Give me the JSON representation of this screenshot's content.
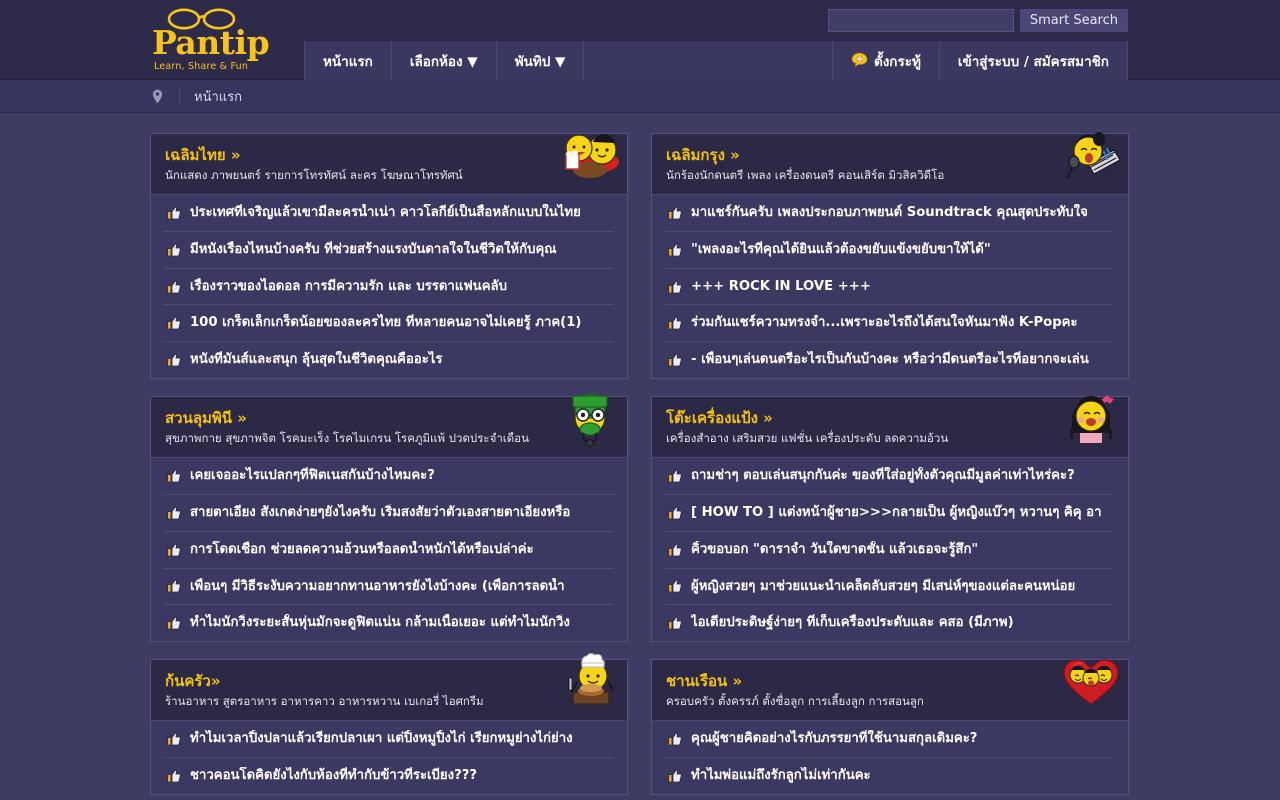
{
  "site": {
    "logo_word": "Pantip",
    "logo_tagline": "Learn, Share & Fun"
  },
  "header": {
    "search": {
      "value": "",
      "placeholder": ""
    },
    "search_button": "Smart Search",
    "nav": [
      {
        "label": "หน้าแรก",
        "icon": ""
      },
      {
        "label": "เลือกห้อง ▼",
        "icon": ""
      },
      {
        "label": "พันทิป ▼",
        "icon": ""
      }
    ],
    "nav_right": [
      {
        "label": "ตั้งกระทู้",
        "icon": "speech-bubble-plus-icon"
      },
      {
        "label": "เข้าสู่ระบบ / สมัครสมาชิก",
        "icon": ""
      }
    ]
  },
  "breadcrumb": {
    "icon": "map-pin-icon",
    "text": "หน้าแรก"
  },
  "cards": [
    {
      "title": "เฉลิมไทย »",
      "subtitle": "นักแสดง ภาพยนตร์ รายการโทรทัศน์ ละคร โฆษณาโทรทัศน์",
      "mascot": "popcorn-movie-mascot",
      "items": [
        "ประเทศที่เจริญแล้วเขามีละครน้ำเน่า คาวโลกีย์เป็นสื่อหลักแบบในไทย",
        "มีหนังเรื่องไหนบ้างครับ ที่ช่วยสร้างแรงบันดาลใจในชีวิตให้กับคุณ",
        "เรื่องราวของไอดอล การมีความรัก และ บรรดาแฟนคลับ",
        "100 เกร็ดเล็กเกร็ดน้อยของละครไทย ที่หลายคนอาจไม่เคยรู้ ภาค(1)",
        "หนังที่มันส์และสนุก ลุ้นสุดในชีวิตคุณคืออะไร"
      ]
    },
    {
      "title": "เฉลิมกรุง »",
      "subtitle": "นักร้องนักดนตรี เพลง เครื่องดนตรี คอนเสิร์ต มิวสิควิดีโอ",
      "mascot": "singer-microphone-mascot",
      "items": [
        "มาแชร์กันครับ เพลงประกอบภาพยนต์ Soundtrack คุณสุดประทับใจ",
        "\"เพลงอะไรที่คุณได้ยินแล้วต้องขยับแข้งขยับขาให้ได้\"",
        "+++ ROCK IN LOVE +++",
        "ร่วมกันแชร์ความทรงจำ...เพราะอะไรถึงได้สนใจหันมาฟัง K-Popคะ",
        "- เพื่อนๆเล่นดนตรีอะไรเป็นกันบ้างคะ หรือว่ามีดนตรีอะไรที่อยากจะเล่น"
      ]
    },
    {
      "title": "สวนลุมพินี »",
      "subtitle": "สุขภาพกาย สุขภาพจิต โรคมะเร็ง โรคไมเกรน โรคภูมิแพ้ ปวดประจำเดือน",
      "mascot": "green-doctor-mascot",
      "items": [
        "เคยเจออะไรแปลกๆที่ฟิตเนสกันบ้างไหมคะ?",
        "สายตาเอียง สังเกตง่ายๆยังไงครับ เริ่มสงสัยว่าตัวเองสายตาเอียงหรือ",
        "การโดดเชือก ช่วยลดความอ้วนหรือลดน้ำหนักได้หรือเปล่าค่ะ",
        "เพื่อนๆ มีวิธีระงับความอยากทานอาหารยังไงบ้างคะ (เพื่อการลดน้ำ",
        "ทำไมนักวิ่งระยะสั้นหุ่นมักจะดูฟิตแน่น กล้ามเนื้อเยอะ แต่ทำไมนักวิ่ง"
      ]
    },
    {
      "title": "โต๊ะเครื่องแป้ง »",
      "subtitle": "เครื่องสำอาง เสริมสวย แฟชั่น เครื่องประดับ ลดความอ้วน",
      "mascot": "girl-pink-bow-mascot",
      "items": [
        "ถามช่าๆ ตอบเล่นสนุกกันค่ะ ของที่ใส่อยู่ทั้งตัวคุณมีมูลค่าเท่าไหร่คะ?",
        "[ HOW TO ] แต่งหน้าผู้ชาย>>>กลายเป็น ผู้หญิงแบ๊วๆ หวานๆ คิคุ อา",
        "คิ้วขอบอก \"ดาราจำ วันใดขาดชั้น แล้วเธอจะรู้สึก\"",
        "ผู้หญิงสวยๆ มาช่วยแนะนำเคล็ดลับสวยๆ มีเสน่ห์ๆของแต่ละคนหน่อย",
        "ไอเดียประดิษฐ์ง่ายๆ ที่เก็บเครื่องประดับและ คสอ (มีภาพ)"
      ]
    },
    {
      "title": "ก้นครัว»",
      "subtitle": "ร้านอาหาร สูตรอาหาร อาหารคาว อาหารหวาน เบเกอรี่ ไอศกรีม",
      "mascot": "chef-cooking-mascot",
      "items": [
        "ทำไมเวลาปิ้งปลาแล้วเรียกปลาเผา แต่ปิ้งหมูปิ้งไก่ เรียกหมูย่างไก่ย่าง",
        "ชาวคอนโดคิดยังไงกับห้องที่ทำกับข้าวที่ระเบียง???"
      ]
    },
    {
      "title": "ชานเรือน »",
      "subtitle": "ครอบครัว ตั้งครรภ์ ตั้งชื่อลูก การเลี้ยงลูก การสอนลูก",
      "mascot": "family-heart-mascot",
      "items": [
        "คุณผู้ชายคิดอย่างไรกับภรรยาที่ใช้นามสกุลเดิมคะ?",
        "ทำไมพ่อแม่ถึงรักลูกไม่เท่ากันคะ"
      ]
    }
  ],
  "colors": {
    "header_bg": "#2d2a4a",
    "breadcrumb_bg": "#363560",
    "page_bg": "#3e3c63",
    "card_bg": "#3b3961",
    "card_head_bg": "#2b2945",
    "accent_yellow": "#f4c20d",
    "border": "#55527f"
  }
}
